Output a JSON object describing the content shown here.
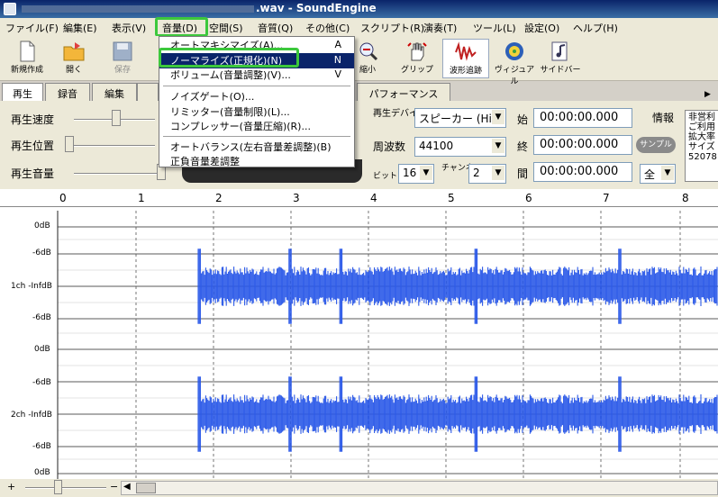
{
  "window": {
    "title": ".wav - SoundEngine"
  },
  "menubar": [
    "ファイル(F)",
    "編集(E)",
    "表示(V)",
    "音量(D)",
    "空間(S)",
    "音質(Q)",
    "その他(C)",
    "スクリプト(R)",
    "演奏(T)",
    "ツール(L)",
    "設定(O)",
    "ヘルプ(H)"
  ],
  "toolbar": {
    "new": "新規作成",
    "open": "開く",
    "save": "保存",
    "normalize": "縮小",
    "grip": "グリップ",
    "waveform": "波形追跡",
    "visual": "ヴィジュアル",
    "sidebar": "サイドバー"
  },
  "tabs": [
    "再生",
    "録音",
    "編集",
    "パフォーマンス"
  ],
  "controls": {
    "speed": "再生速度",
    "position": "再生位置",
    "volume": "再生音量",
    "device_label": "再生デバイス",
    "device_value": "スピーカー (Hi",
    "freq_label": "周波数",
    "freq_value": "44100",
    "bit_label": "ビット",
    "bit_value": "16",
    "ch_label": "チャンネル",
    "ch_value": "2",
    "start_label": "始",
    "start_value": "00:00:00.000",
    "end_label": "終",
    "end_value": "00:00:00.000",
    "len_label": "間",
    "len_value": "00:00:00.000",
    "info_label": "情報",
    "sample_label": "サンプル",
    "range_value": "全",
    "info_text": [
      "非営利",
      "ご利用",
      "拡大率",
      "サイズ",
      "52078"
    ]
  },
  "ruler": [
    "0",
    "1",
    "2",
    "3",
    "4",
    "5",
    "6",
    "7",
    "8"
  ],
  "tracks": [
    {
      "labels": [
        "0dB",
        "-6dB",
        "1ch -InfdB",
        "-6dB",
        "0dB"
      ]
    },
    {
      "labels": [
        "-6dB",
        "2ch -InfdB",
        "-6dB",
        "0dB"
      ]
    }
  ],
  "menu": {
    "items": [
      {
        "label": "オートマキシマイズ(A)...",
        "key": "A"
      },
      {
        "label": "ノーマライズ(正規化)(N)",
        "key": "N"
      },
      {
        "label": "ボリューム(音量調整)(V)...",
        "key": "V"
      },
      {
        "label": "ノイズゲート(O)..."
      },
      {
        "label": "リミッター(音量制限)(L)..."
      },
      {
        "label": "コンプレッサー(音量圧縮)(R)..."
      },
      {
        "label": "オートバランス(左右音量差調整)(B)"
      },
      {
        "label": "正負音量差調整"
      }
    ]
  },
  "status": {
    "plus": "+",
    "minus": "−"
  }
}
